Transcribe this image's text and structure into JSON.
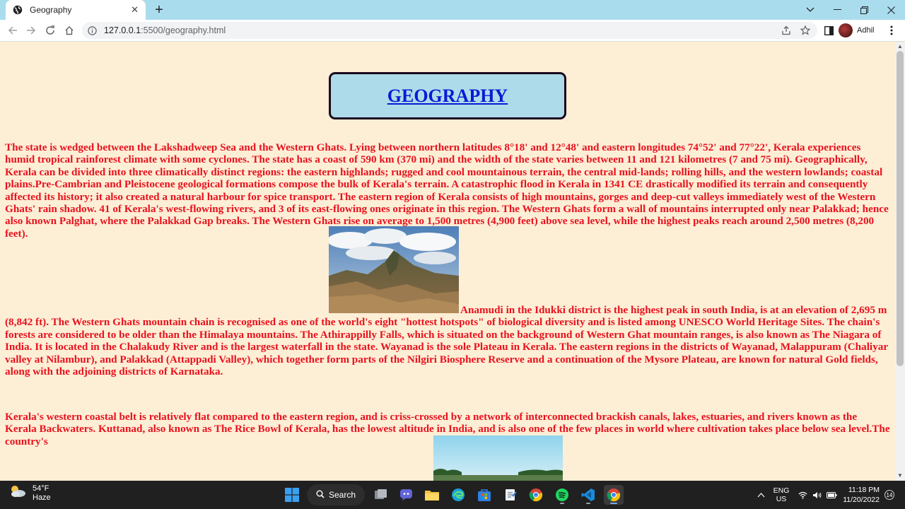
{
  "browser": {
    "tab_title": "Geography",
    "new_tab_symbol": "+",
    "url_host": "127.0.0.1",
    "url_path": ":5500/geography.html",
    "profile_name": "Adhil"
  },
  "page": {
    "heading": "GEOGRAPHY",
    "paragraph1": "The state is wedged between the Lakshadweep Sea and the Western Ghats. Lying between northern latitudes 8°18' and 12°48' and eastern longitudes 74°52' and 77°22', Kerala experiences humid tropical rainforest climate with some cyclones. The state has a coast of 590 km (370 mi) and the width of the state varies between 11 and 121 kilometres (7 and 75 mi). Geographically, Kerala can be divided into three climatically distinct regions: the eastern highlands; rugged and cool mountainous terrain, the central mid-lands; rolling hills, and the western lowlands; coastal plains.Pre-Cambrian and Pleistocene geological formations compose the bulk of Kerala's terrain. A catastrophic flood in Kerala in 1341 CE drastically modified its terrain and consequently affected its history; it also created a natural harbour for spice transport. The eastern region of Kerala consists of high mountains, gorges and deep-cut valleys immediately west of the Western Ghats' rain shadow. 41 of Kerala's west-flowing rivers, and 3 of its east-flowing ones originate in this region. The Western Ghats form a wall of mountains interrupted only near Palakkad; hence also known Palghat, where the Palakkad Gap breaks. The Western Ghats rise on average to 1,500 metres (4,900 feet) above sea level, while the highest peaks reach around 2,500 metres (8,200 feet).",
    "paragraph2": "Anamudi in the Idukki district is the highest peak in south India, is at an elevation of 2,695 m (8,842 ft). The Western Ghats mountain chain is recognised as one of the world's eight \"hottest hotspots\" of biological diversity and is listed among UNESCO World Heritage Sites. The chain's forests are considered to be older than the Himalaya mountains. The Athirappilly Falls, which is situated on the background of Western Ghat mountain ranges, is also known as The Niagara of India. It is located in the Chalakudy River and is the largest waterfall in the state. Wayanad is the sole Plateau in Kerala. The eastern regions in the districts of Wayanad, Malappuram (Chaliyar valley at Nilambur), and Palakkad (Attappadi Valley), which together form parts of the Nilgiri Biosphere Reserve and a continuation of the Mysore Plateau, are known for natural Gold fields, along with the adjoining districts of Karnataka.",
    "paragraph3": "Kerala's western coastal belt is relatively flat compared to the eastern region, and is criss-crossed by a network of interconnected brackish canals, lakes, estuaries, and rivers known as the Kerala Backwaters. Kuttanad, also known as The Rice Bowl of Kerala, has the lowest altitude in India, and is also one of the few places in world where cultivation takes place below sea level.The country's"
  },
  "taskbar": {
    "temperature": "54°F",
    "weather_desc": "Haze",
    "search_label": "Search",
    "lang_line1": "ENG",
    "lang_line2": "US",
    "time": "11:18 PM",
    "date": "11/20/2022",
    "notification_count": "14"
  },
  "colors": {
    "page_background": "#fdeed6",
    "paragraph_text": "#e8121d",
    "heading_link": "#0a1ad6",
    "heading_box": "#aedbe9",
    "tabstrip": "#a9ddee"
  }
}
